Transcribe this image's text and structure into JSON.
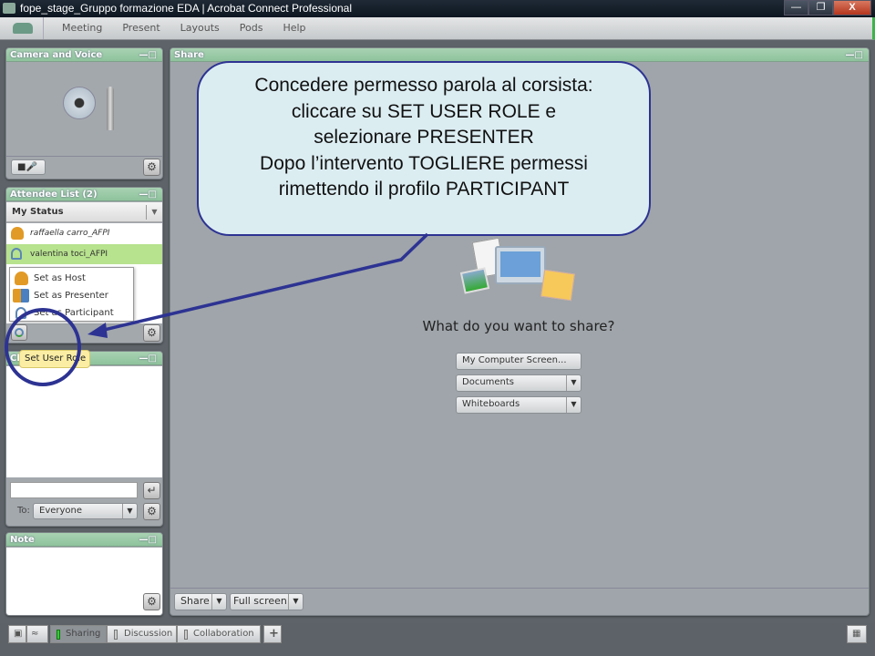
{
  "window": {
    "title": "fope_stage_Gruppo formazione EDA | Acrobat Connect Professional",
    "controls": [
      "minimize-icon",
      "restore-icon",
      "close-icon"
    ]
  },
  "menu": [
    "Meeting",
    "Present",
    "Layouts",
    "Pods",
    "Help"
  ],
  "camera_pod": {
    "title": "Camera and Voice",
    "icons": [
      "webcam-icon",
      "microphone-icon"
    ]
  },
  "attendee_pod": {
    "title": "Attendee List (2)",
    "status_label": "My Status",
    "attendees": [
      {
        "name": "raffaella carro_AFPI",
        "role": "host"
      },
      {
        "name": "valentina toci_AFPI",
        "role": "participant",
        "selected": true
      }
    ],
    "role_menu": [
      "Set as Host",
      "Set as Presenter",
      "Set as Participant"
    ],
    "tooltip": "Set User Role"
  },
  "chat_pod": {
    "title": "Chat",
    "to_label": "To:",
    "recipient": "Everyone",
    "message_value": ""
  },
  "note_pod": {
    "title": "Note"
  },
  "share_pod": {
    "title": "Share",
    "prompt": "What do you want to share?",
    "options": [
      "My Computer Screen...",
      "Documents",
      "Whiteboards"
    ],
    "footer": [
      "Share",
      "Full screen"
    ]
  },
  "callout": {
    "lines": [
      "Concedere permesso parola al corsista:",
      "cliccare su SET USER ROLE e",
      "selezionare PRESENTER",
      "Dopo l’intervento TOGLIERE permessi",
      "rimettendo il profilo PARTICIPANT"
    ],
    "color": "#2d3392"
  },
  "taskbar": {
    "tabs": [
      "Sharing",
      "Discussion",
      "Collaboration"
    ],
    "active": "Sharing",
    "add_label": "+"
  }
}
